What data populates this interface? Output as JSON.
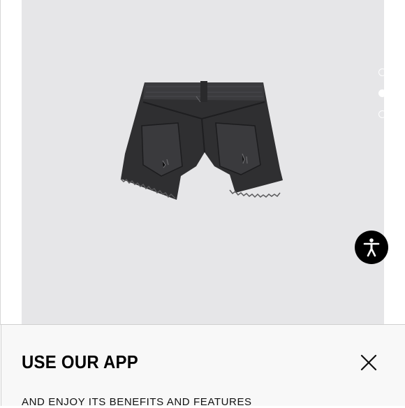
{
  "sheet": {
    "title": "USE OUR APP",
    "subtitle": "AND ENJOY ITS BENEFITS AND FEATURES",
    "close_icon": "close-icon"
  },
  "gallery": {
    "image_count": 3,
    "active_index": 1,
    "background_color": "#e6e6e8"
  },
  "accessibility": {
    "icon": "accessibility-icon",
    "color": "#000000"
  }
}
